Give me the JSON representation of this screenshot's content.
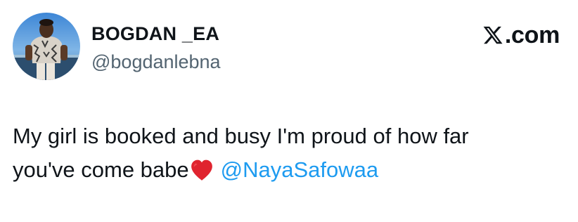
{
  "author": {
    "display_name": "BOGDAN _EA",
    "handle": "@bogdanlebna"
  },
  "brand": {
    "icon": "x-logo-icon",
    "suffix": ".com"
  },
  "tweet": {
    "line1": "My girl is booked and busy I'm proud of how far",
    "line2": "you've come babe",
    "emoji": "red-heart-icon",
    "mention": "@NayaSafowaa"
  },
  "colors": {
    "text": "#0f1419",
    "secondary": "#536471",
    "mention": "#1d9bf0",
    "heart": "#e0242f"
  }
}
